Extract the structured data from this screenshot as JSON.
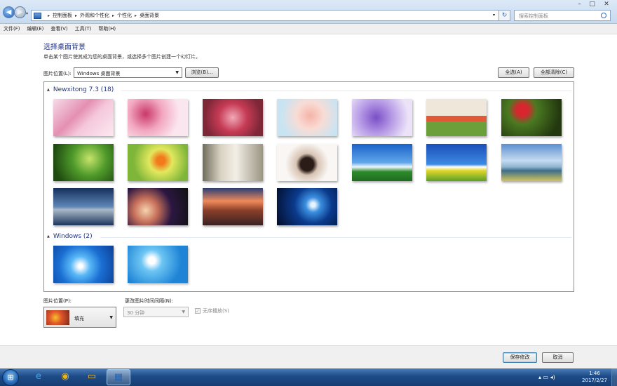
{
  "window": {
    "minimize": "–",
    "maximize": "□",
    "close": "✕"
  },
  "nav": {
    "back": "◀",
    "forward": "▶",
    "recent": "▾"
  },
  "address": {
    "breadcrumbs": [
      "控制面板",
      "外观和个性化",
      "个性化",
      "桌面背景"
    ],
    "separator": "▸",
    "dropdown": "▾",
    "refresh": "↻"
  },
  "search": {
    "placeholder": "搜索控制面板"
  },
  "menu": [
    "文件(F)",
    "编辑(E)",
    "查看(V)",
    "工具(T)",
    "帮助(H)"
  ],
  "page": {
    "title": "选择桌面背景",
    "subtitle": "单击某个图片使其成为您的桌面背景，或选择多个图片创建一个幻灯片。",
    "location_label": "图片位置(L):",
    "location_value": "Windows 桌面背景",
    "browse": "浏览(B)...",
    "select_all": "全选(A)",
    "clear_all": "全部清除(C)"
  },
  "groups": [
    {
      "title": "Newxitong 7.3 (18)",
      "collapse": "▲"
    },
    {
      "title": "Windows (2)",
      "collapse": "▲"
    }
  ],
  "thumb_names": [
    "pink-blossom-thumb-1",
    "pink-blossom-thumb-2",
    "red-blossom-thumb",
    "peach-blossom-thumb",
    "purple-flowers-thumb",
    "tulip-field-thumb",
    "red-tulips-thumb",
    "green-leaves-thumb",
    "lantern-flower-thumb",
    "girl-portrait-thumb-1",
    "girl-portrait-thumb-2",
    "blue-sky-field-thumb-1",
    "blue-sky-field-thumb-2",
    "cloud-landscape-thumb",
    "night-ocean-thumb",
    "bokeh-thumb",
    "mountain-sunset-thumb",
    "windows10-thumb",
    "windows7-logo-thumb",
    "daisy-thumb"
  ],
  "controls": {
    "position_label": "图片位置(P):",
    "position_value": "填充",
    "interval_label": "更改图片时间间隔(N):",
    "interval_value": "30 分钟",
    "shuffle_label": "无序播放(S)",
    "shuffle_checked": true,
    "checkmark": "✓"
  },
  "footer": {
    "save": "保存修改",
    "cancel": "取消"
  },
  "taskbar": {
    "start": "⊞",
    "apps": [
      {
        "name": "ie",
        "glyph": "e"
      },
      {
        "name": "chrome",
        "glyph": "◉"
      },
      {
        "name": "explorer",
        "glyph": "▭"
      },
      {
        "name": "control-panel",
        "glyph": "▦"
      }
    ],
    "tray_icons": "▴  ▭  ◂)",
    "time": "1:46",
    "date": "2017/2/27"
  }
}
